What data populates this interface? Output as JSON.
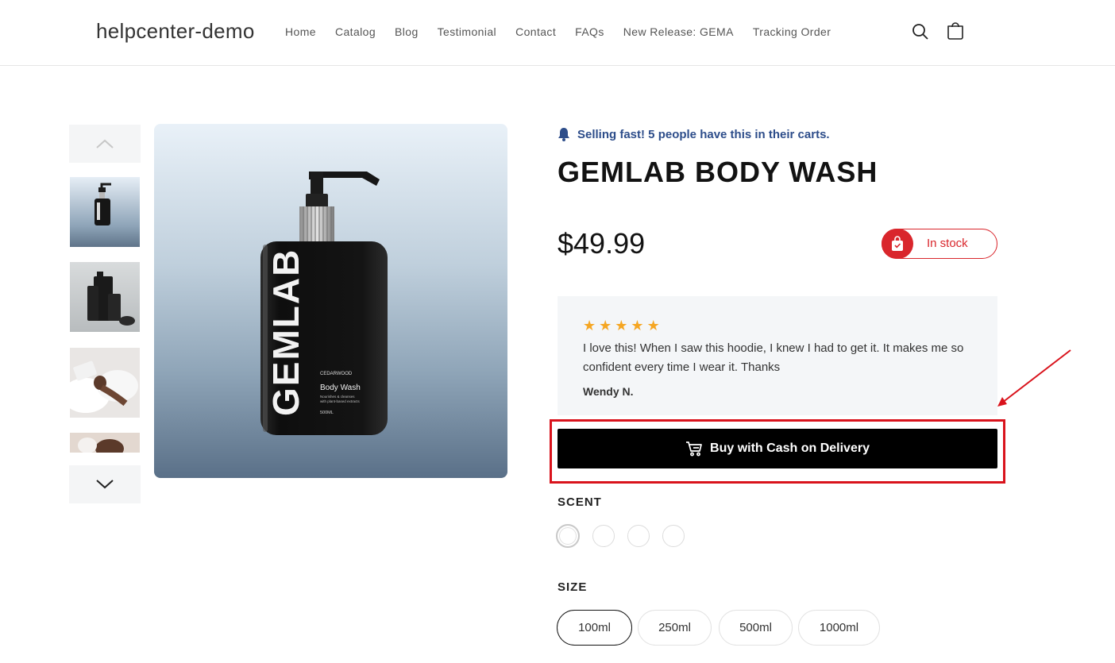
{
  "header": {
    "brand": "helpcenter-demo",
    "nav": [
      "Home",
      "Catalog",
      "Blog",
      "Testimonial",
      "Contact",
      "FAQs",
      "New Release: GEMA",
      "Tracking Order"
    ],
    "icons": [
      "search-icon",
      "cart-icon"
    ]
  },
  "product": {
    "selling_fast": "Selling fast! 5 people have this in their carts.",
    "title": "GEMLAB BODY WASH",
    "price": "$49.99",
    "stock": "In stock",
    "bottle": {
      "brand": "GEMLAB",
      "scent": "CEDARWOOD",
      "name": "Body Wash",
      "desc1": "Nourishes & cleanses",
      "desc2": "with plant-based extracts",
      "volume": "500ML"
    }
  },
  "review": {
    "rating": 5,
    "text": "I love this! When I saw this hoodie, I knew I had to get it. It makes me so confident every time I wear it. Thanks",
    "author": "Wendy N."
  },
  "cod_button": "Buy with Cash on Delivery",
  "scent": {
    "label": "SCENT",
    "selected_index": 0
  },
  "size": {
    "label": "SIZE",
    "options": [
      "100ml",
      "250ml",
      "500ml",
      "1000ml"
    ],
    "selected": "100ml"
  },
  "colors": {
    "accent_blue": "#2d4d8a",
    "stock_red": "#d9262c",
    "star": "#f5a623",
    "annotation_red": "#d9131c"
  }
}
